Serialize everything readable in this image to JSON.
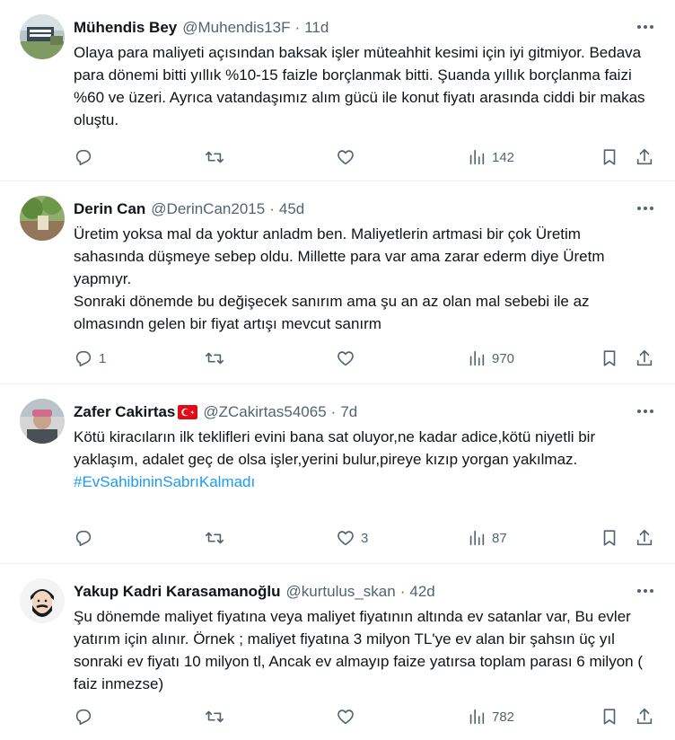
{
  "tweets": [
    {
      "name": "Mühendis Bey",
      "handle": "@Muhendis13F",
      "separator": "·",
      "time": "11d",
      "text": "Olaya para maliyeti açısından baksak işler müteahhit kesimi için iyi gitmiyor. Bedava para dönemi bitti yıllık %10-15 faizle borçlanmak bitti. Şuanda yıllık borçlanma faizi %60 ve üzeri. Ayrıca vatandaşımız alım gücü ile konut fiyatı arasında ciddi bir makas oluştu.",
      "replies": "",
      "retweets": "",
      "likes": "",
      "views": "142"
    },
    {
      "name": "Derin Can",
      "handle": "@DerinCan2015",
      "separator": "·",
      "time": "45d",
      "text": "Üretim yoksa mal da yoktur anladm ben. Maliyetlerin artmasi bir çok Üretim sahasında düşmeye sebep oldu. Millette para var ama zarar ederm diye Üretm yapmıyr.\nSonraki dönemde bu değişecek sanırım ama şu an az olan mal sebebi ile az olmasındn gelen bir fiyat artışı mevcut sanırm",
      "replies": "1",
      "retweets": "",
      "likes": "",
      "views": "970"
    },
    {
      "name": "Zafer Cakirtas",
      "flag": "🇹🇷",
      "handle": "@ZCakirtas54065",
      "separator": "·",
      "time": "7d",
      "text": "Kötü kiracıların ilk teklifleri evini bana sat oluyor,ne kadar adice,kötü niyetli bir yaklaşım, adalet geç de olsa işler,yerini bulur,pireye kızıp yorgan yakılmaz.",
      "hashtag": "#EvSahibininSabrıKalmadı",
      "replies": "",
      "retweets": "",
      "likes": "3",
      "views": "87"
    },
    {
      "name": "Yakup Kadri Karasamanoğlu",
      "handle": "@kurtulus_skan",
      "separator": "·",
      "time": "42d",
      "text": "Şu dönemde maliyet fiyatına veya maliyet fiyatının altında ev satanlar var, Bu evler yatırım için alınır. Örnek ; maliyet fiyatına 3 milyon TL'ye ev alan bir şahsın üç yıl sonraki ev fiyatı 10 milyon tl, Ancak ev almayıp faize yatırsa toplam parası 6 milyon ( faiz inmezse)",
      "replies": "",
      "retweets": "",
      "likes": "",
      "views": "782"
    }
  ],
  "icons": {
    "more": "more-horizontal-icon",
    "reply": "reply-icon",
    "retweet": "retweet-icon",
    "like": "heart-icon",
    "views": "views-chart-icon",
    "bookmark": "bookmark-icon",
    "share": "share-icon"
  },
  "colors": {
    "text": "#0f1419",
    "secondary": "#536471",
    "link": "#1d9bf0",
    "divider": "#eff3f4"
  }
}
